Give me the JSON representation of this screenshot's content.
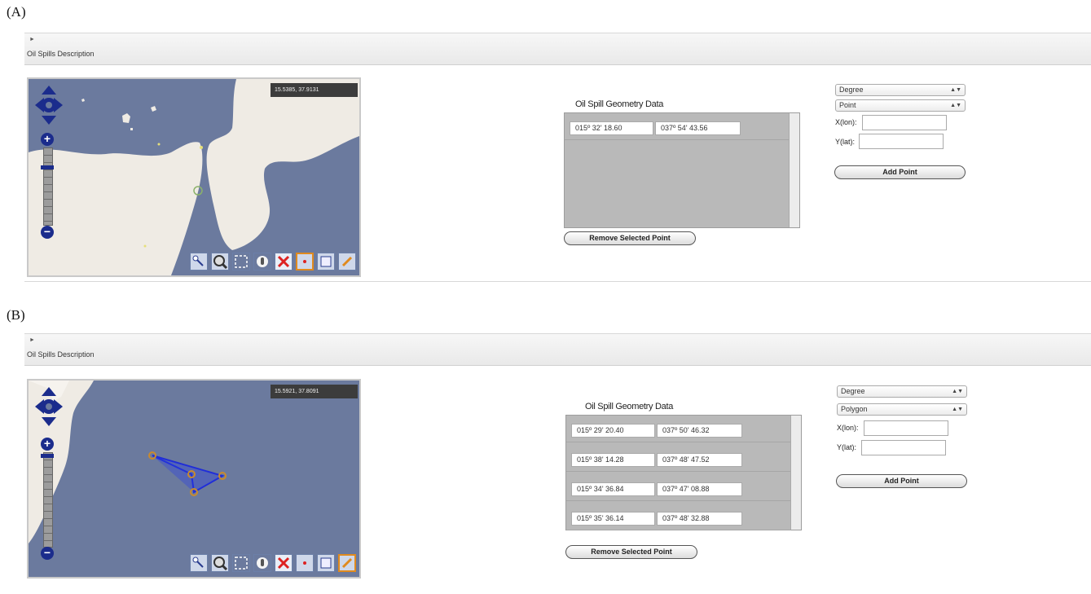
{
  "panel_a": {
    "label": "(A)",
    "section_title": "Oil Spills Description",
    "map": {
      "coordinate_readout": "15.5385, 37.9131"
    },
    "geometry_title": "Oil Spill Geometry Data",
    "rows": [
      {
        "lon": "015º 32' 18.60",
        "lat": "037º 54' 43.56"
      }
    ],
    "remove_button": "Remove Selected Point",
    "unit_select": "Degree",
    "geometry_select": "Point",
    "x_label": "X(lon):",
    "y_label": "Y(lat):",
    "add_button": "Add Point",
    "active_tool": "point-tool"
  },
  "panel_b": {
    "label": "(B)",
    "section_title": "Oil Spills Description",
    "map": {
      "coordinate_readout": "15.5921, 37.8091"
    },
    "geometry_title": "Oil Spill Geometry Data",
    "rows": [
      {
        "lon": "015º 29' 20.40",
        "lat": "037º 50' 46.32"
      },
      {
        "lon": "015º 38' 14.28",
        "lat": "037º 48' 47.52"
      },
      {
        "lon": "015º 34' 36.84",
        "lat": "037º 47' 08.88"
      },
      {
        "lon": "015º 35' 36.14",
        "lat": "037º 48' 32.88"
      }
    ],
    "remove_button": "Remove Selected Point",
    "unit_select": "Degree",
    "geometry_select": "Polygon",
    "x_label": "X(lon):",
    "y_label": "Y(lat):",
    "add_button": "Add Point",
    "active_tool": "polygon-tool"
  },
  "colors": {
    "sea": "#6b7a9e",
    "land": "#efebe4",
    "polygon_stroke": "#1f2bd6",
    "vertex": "#c98a2e",
    "active_tool_border": "#e08a1e"
  },
  "icons": {
    "pan": "pan-arrows-icon",
    "zoom_in": "plus-icon",
    "zoom_out": "minus-icon",
    "tools": [
      "zoom-box-icon",
      "zoom-glass-icon",
      "select-box-icon",
      "hand-icon",
      "delete-feature-icon",
      "point-tool-icon",
      "line-tool-icon",
      "polygon-tool-icon"
    ]
  }
}
